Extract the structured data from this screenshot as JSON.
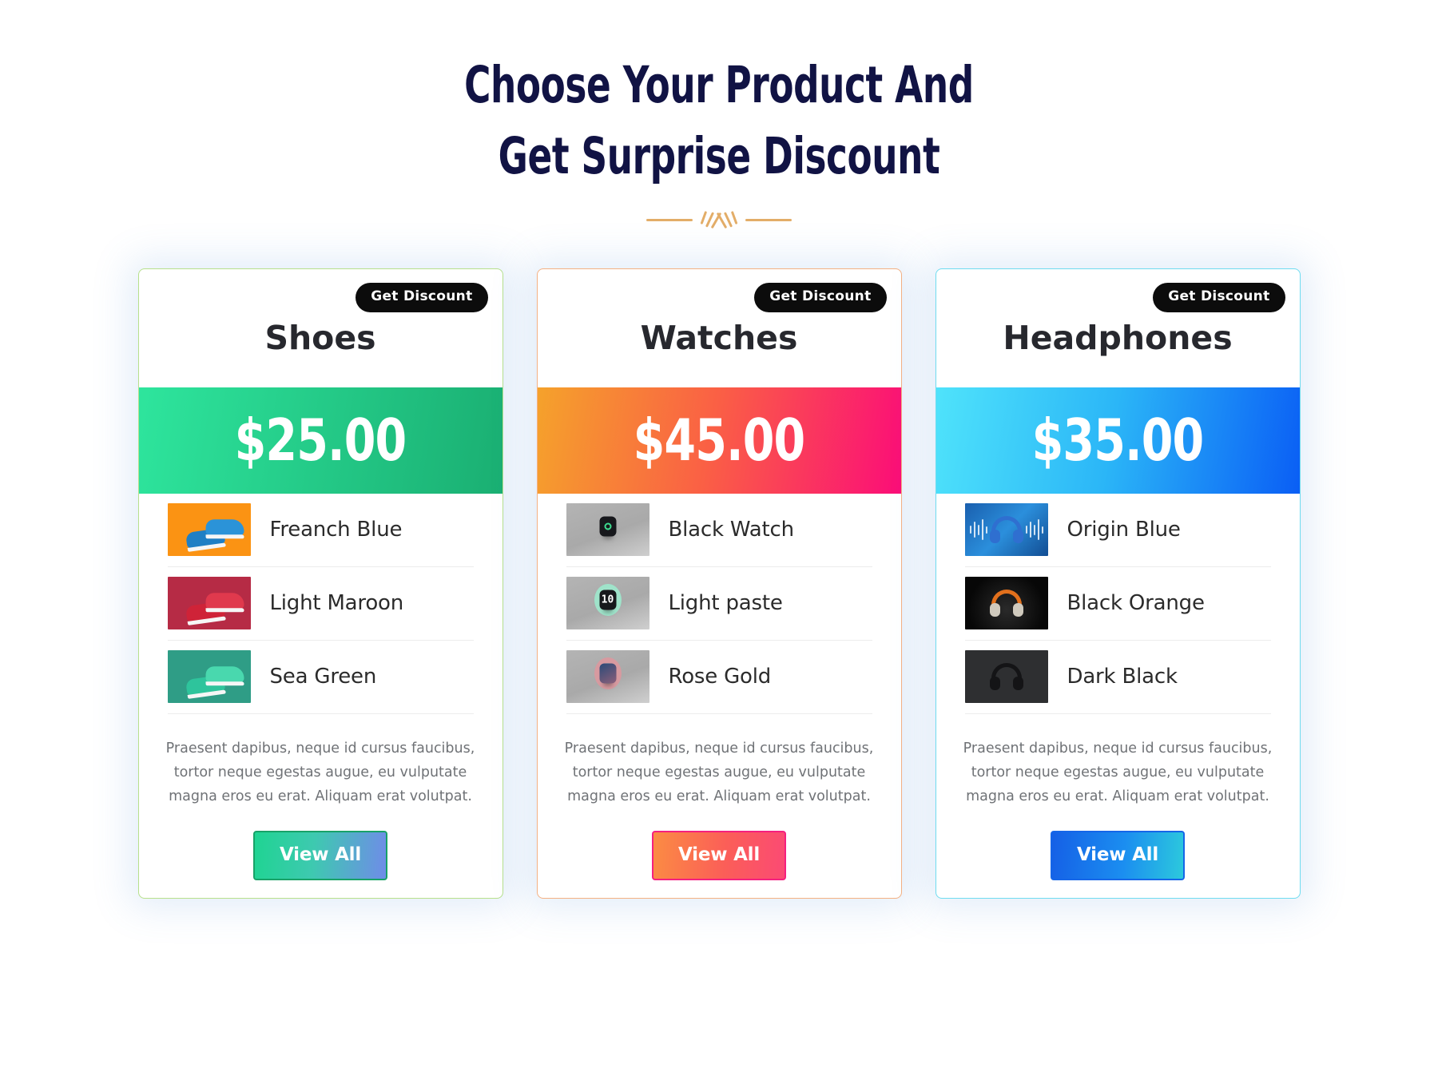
{
  "heading": {
    "line1": "Choose Your Product And",
    "line2": "Get Surprise Discount",
    "divider_icon": "ornament-divider-icon",
    "divider_color": "#e3ad68",
    "text_color": "#111344"
  },
  "cards": [
    {
      "badge_label": "Get Discount",
      "title": "Shoes",
      "price": "$25.00",
      "accent": "#2ee59d",
      "border_color": "#b7e08c",
      "products": [
        {
          "name": "Freanch Blue",
          "thumb_icon": "shoe-blue-thumbnail",
          "thumb_bg": "#fb9313"
        },
        {
          "name": "Light Maroon",
          "thumb_icon": "shoe-red-thumbnail",
          "thumb_bg": "#b62b45"
        },
        {
          "name": "Sea Green",
          "thumb_icon": "shoe-green-thumbnail",
          "thumb_bg": "#2f9d86"
        }
      ],
      "description": "Praesent dapibus, neque id cursus faucibus, tortor neque egestas augue, eu vulputate magna eros eu erat. Aliquam erat volutpat.",
      "button_label": "View All"
    },
    {
      "badge_label": "Get Discount",
      "title": "Watches",
      "price": "$45.00",
      "accent": "#fb0d78",
      "border_color": "#f4b183",
      "products": [
        {
          "name": "Black Watch",
          "thumb_icon": "watch-black-thumbnail",
          "thumb_bg": "#b0b0b0"
        },
        {
          "name": "Light paste",
          "thumb_icon": "watch-mint-thumbnail",
          "thumb_bg": "#b0b0b0"
        },
        {
          "name": "Rose Gold",
          "thumb_icon": "watch-rosegold-thumbnail",
          "thumb_bg": "#b0b0b0"
        }
      ],
      "description": "Praesent dapibus, neque id cursus faucibus, tortor neque egestas augue, eu vulputate magna eros eu erat. Aliquam erat volutpat.",
      "button_label": "View All"
    },
    {
      "badge_label": "Get Discount",
      "title": "Headphones",
      "price": "$35.00",
      "accent": "#0a5ef5",
      "border_color": "#6fdcf0",
      "products": [
        {
          "name": "Origin Blue",
          "thumb_icon": "headphone-blue-thumbnail",
          "thumb_bg": "#1a5fae"
        },
        {
          "name": "Black Orange",
          "thumb_icon": "headphone-orange-thumbnail",
          "thumb_bg": "#070707"
        },
        {
          "name": "Dark Black",
          "thumb_icon": "headphone-black-thumbnail",
          "thumb_bg": "#2e2f31"
        }
      ],
      "description": "Praesent dapibus, neque id cursus faucibus, tortor neque egestas augue, eu vulputate magna eros eu erat. Aliquam erat volutpat.",
      "button_label": "View All"
    }
  ]
}
